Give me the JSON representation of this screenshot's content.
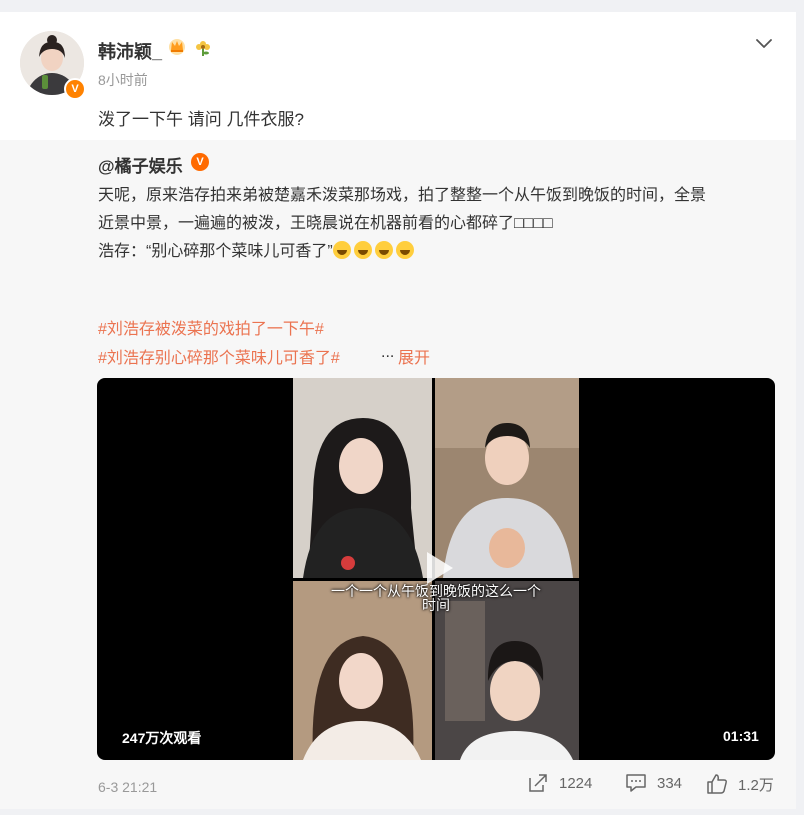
{
  "post": {
    "username": "韩沛颖_",
    "time": "8小时前",
    "text": "泼了一下午 请问 几件衣服?"
  },
  "repost": {
    "author": "@橘子娱乐",
    "lines": [
      "天呢，原来浩存拍来弟被楚嘉禾泼菜那场戏，拍了整整一个从午饭到晚饭的时间，全景",
      "近景中景，一遍遍的被泼，王晓晨说在机器前看的心都碎了□□□□",
      "浩存：“别心碎那个菜味儿可香了”"
    ],
    "hashtags": [
      "#刘浩存被泼菜的戏拍了一下午#",
      "#刘浩存别心碎那个菜味儿可香了#"
    ],
    "more": "...",
    "expand": "展开",
    "video": {
      "subtitle_line1": "一个一个从午饭到晚饭的这么一个",
      "subtitle_line2": "时间",
      "views": "247万次观看",
      "duration": "01:31"
    },
    "date": "6-3 21:21",
    "reposts": "1224",
    "comments": "334",
    "likes": "1.2万"
  },
  "colors": {
    "accent": "#eb7350",
    "verify": "#ff8200",
    "muted": "#999999"
  },
  "icons": [
    "chevron-down-icon",
    "crown-icon",
    "flower-icon",
    "verify-icon",
    "play-icon",
    "repost-icon",
    "comment-icon",
    "like-icon",
    "emoji-icon"
  ]
}
